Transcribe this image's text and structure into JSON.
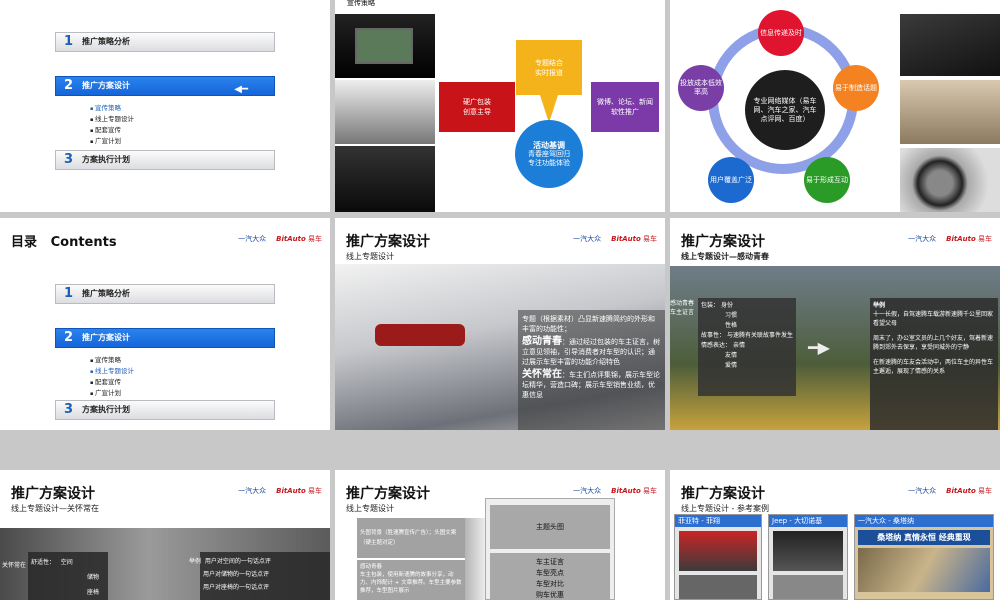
{
  "menu": {
    "item1": "推广策略分析",
    "item2": "推广方案设计",
    "item3": "方案执行计划",
    "n1": "1",
    "n2": "2",
    "n3": "3",
    "sub": [
      "宣传策略",
      "线上专题设计",
      "配套宣传",
      "广宣计划"
    ]
  },
  "slide2": {
    "header": "宣传策略",
    "top_box": "专题结合\n实时报道",
    "left_box": "硬广包装\n创意主导",
    "right_box": "微博、论坛、新闻\n软性推广",
    "center_title": "活动基调",
    "center_text": "青春座驾回归\n专注功能体验"
  },
  "slide3": {
    "center": "专业网络媒体（易车网、汽车之家、汽车点评网、百度）",
    "nodes": [
      "信息传递及时",
      "易于制造话题",
      "易于形成互动",
      "用户覆盖广泛",
      "投放成本低效率高"
    ]
  },
  "slide4": {
    "title": "目录",
    "title_en": "Contents"
  },
  "brands": {
    "faw": "一汽大众",
    "bitauto": "BitAuto",
    "bitauto_cn": "易车"
  },
  "slide5": {
    "title": "推广方案设计",
    "sub": "线上专题设计",
    "p1": "专题（根据素材）凸显新速腾简约的外形和丰富的功能性；",
    "h2": "感动青春",
    "p2": "：通过经过包装的车主证言，树立意见领袖，引导消费者对车型的认识；通过展示车型丰富的功能介绍特色",
    "h3": "关怀常在",
    "p3": "：车主们点评集锦，展示车型论坛精华，营造口碑；展示车型销售业绩，优惠信息"
  },
  "slide6": {
    "title": "推广方案设计",
    "sub": "线上专题设计—感动青春",
    "left_labels": [
      "感动青春车主证言"
    ],
    "col_a": [
      "包装：",
      "故事性：",
      "情感表达："
    ],
    "col_b": [
      "身份",
      "习惯",
      "性格",
      "与速腾有关联故事件发生",
      "亲情",
      "友情",
      "爱情"
    ],
    "right_h": "举例",
    "right_1": "十一长假，自驾速腾车载游新速腾千公里回家看望父母",
    "right_2": "周末了，办公室文员的上几个好友，驾着新速腾到郊外去保享，享受同城外的宁静",
    "right_3": "在新速腾的车友会活动中，两位车主的异性车主邂逅，展现了情感的关系"
  },
  "slide7": {
    "title": "推广方案设计",
    "sub": "线上专题设计—关怀常在",
    "left": "关怀常在",
    "lbl": "舒适性：",
    "items": [
      "空间",
      "储物",
      "座椅"
    ],
    "h": "举例",
    "r": [
      "用户对空间的一句话点评",
      "用户对储物的一句话点评",
      "用户对座椅的一句话点评"
    ]
  },
  "slide8": {
    "title": "推广方案设计",
    "sub": "线上专题设计",
    "l1": "头图背景（胜速腾宣传广告）；头图文案（硬主题对定）",
    "l2": "感动青春\n车主包装，使用新速腾的故事分享，动力、内饰配计 + 文章推荐。车型主要参数推荐，车型图片展示",
    "r1": "主题头图",
    "r2": [
      "车主证言",
      "车型亮点",
      "车型对比",
      "购车优惠"
    ]
  },
  "slide9": {
    "title": "推广方案设计",
    "sub": "线上专题设计 - 参考案例",
    "c1": "菲亚特 - 菲翔",
    "c2": "Jeep - 大切诺基",
    "c3": "一汽大众 - 桑塔纳",
    "banner": "桑塔纳 真情永恒 经典重现"
  }
}
